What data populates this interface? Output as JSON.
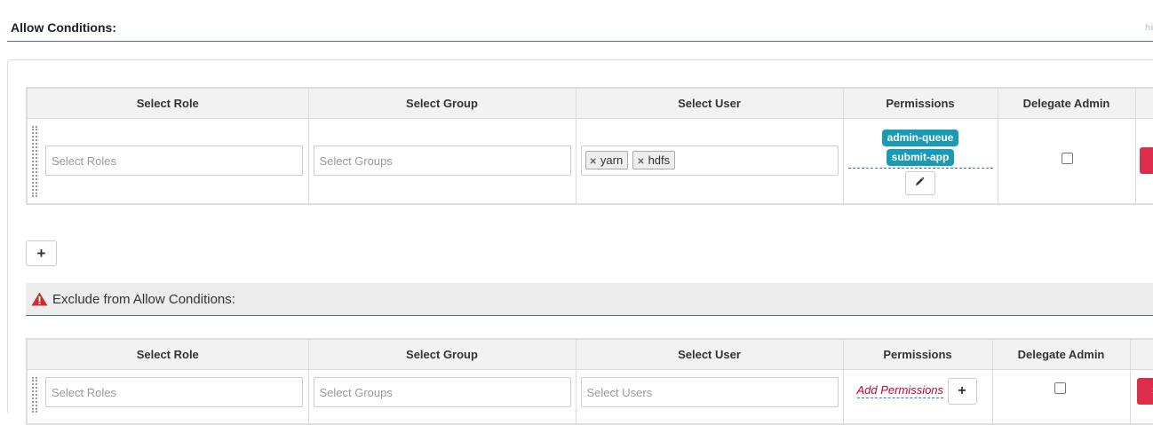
{
  "section": {
    "title": "Allow Conditions:",
    "hint": "hi"
  },
  "headers": [
    "Select Role",
    "Select Group",
    "Select User",
    "Permissions",
    "Delegate Admin"
  ],
  "allow_row": {
    "role_placeholder": "Select Roles",
    "group_placeholder": "Select Groups",
    "users": [
      "yarn",
      "hdfs"
    ],
    "permissions": [
      "admin-queue",
      "submit-app"
    ],
    "delegate_admin": false
  },
  "add_row_label": "+",
  "exclude": {
    "title": "Exclude from Allow Conditions:",
    "role_placeholder": "Select Roles",
    "group_placeholder": "Select Groups",
    "user_placeholder": "Select Users",
    "add_permissions_label": "Add Permissions",
    "add_button_label": "+",
    "delegate_admin": false
  },
  "delete_label": "×",
  "colors": {
    "badge": "#1a9bb3",
    "delete": "#dc2e4c",
    "link": "#c9002b",
    "rule": "#4a6d8c"
  }
}
